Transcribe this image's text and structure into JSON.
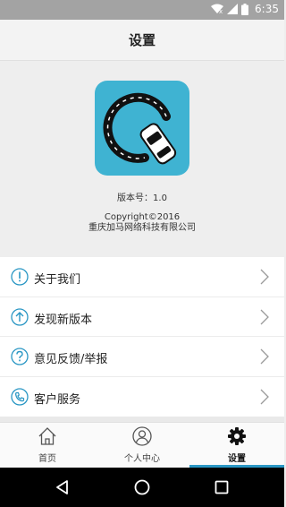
{
  "status_bar": {
    "time": "6:35",
    "icons": [
      "wifi-icon",
      "signal-icon",
      "battery-icon"
    ]
  },
  "header": {
    "title": "设置"
  },
  "about": {
    "app_icon": "app-logo-car-icon",
    "version": "版本号：1.0",
    "copyright": "Copyright©2016",
    "company": "重庆加马网络科技有限公司"
  },
  "menu": {
    "items": [
      {
        "label": "关于我们",
        "icon": "info-icon"
      },
      {
        "label": "发现新版本",
        "icon": "upgrade-arrow-icon"
      },
      {
        "label": "意见反馈/举报",
        "icon": "question-icon"
      },
      {
        "label": "客户服务",
        "icon": "phone-icon"
      }
    ]
  },
  "tabs": [
    {
      "label": "首页",
      "icon": "home-icon",
      "active": false
    },
    {
      "label": "个人中心",
      "icon": "user-icon",
      "active": false
    },
    {
      "label": "设置",
      "icon": "gear-icon",
      "active": true
    }
  ],
  "colors": {
    "accent": "#3fb3d2",
    "active_tab_indicator": "#2a97c4",
    "status_bar": "#a3a3a3"
  },
  "nav": {
    "buttons": [
      "back-icon",
      "home-circle-icon",
      "recents-icon"
    ]
  }
}
